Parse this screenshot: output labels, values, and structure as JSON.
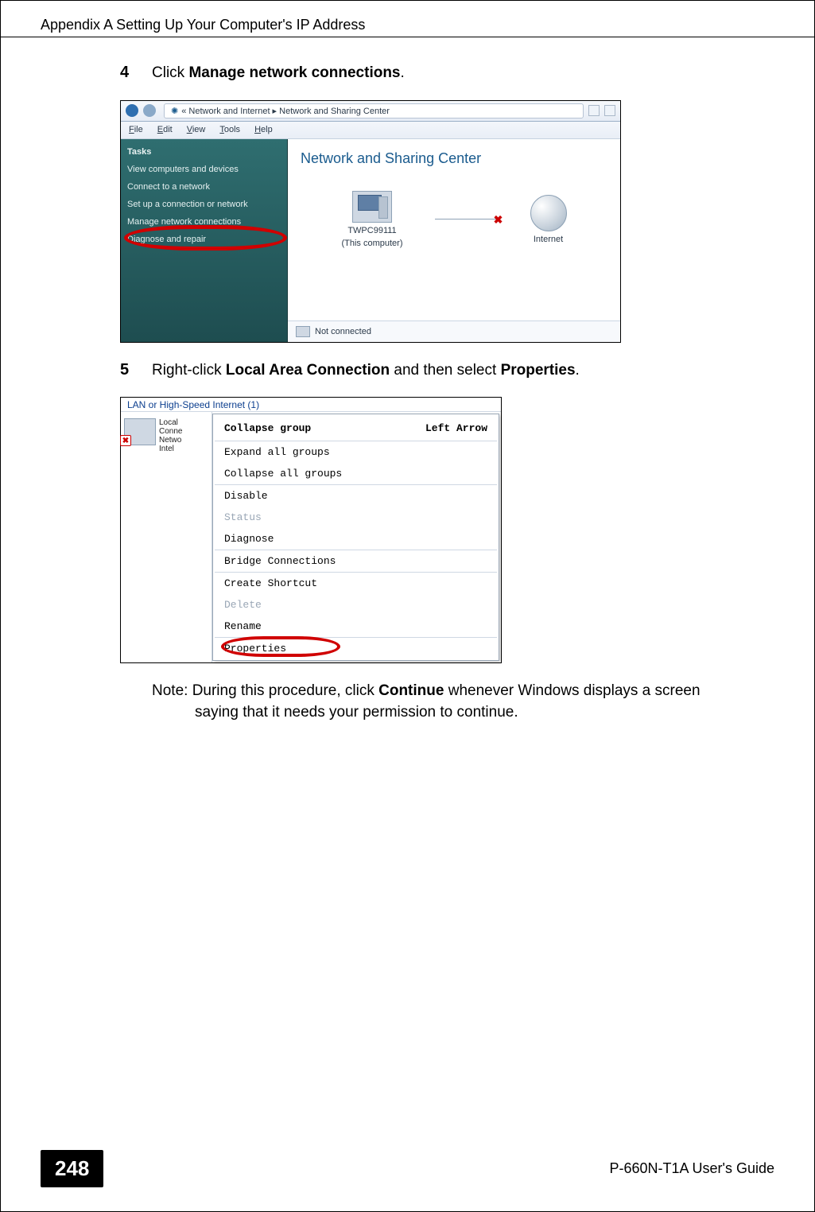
{
  "header": {
    "appendix_title": "Appendix A Setting Up Your Computer's IP Address"
  },
  "steps": {
    "s4": {
      "num": "4",
      "pre": "Click ",
      "bold": "Manage network connections",
      "post": "."
    },
    "s5": {
      "num": "5",
      "pre": "Right-click ",
      "bold1": "Local Area Connection",
      "mid": " and then select ",
      "bold2": "Properties",
      "post": "."
    }
  },
  "fig1": {
    "breadcrumb": "« Network and Internet  ▸  Network and Sharing Center",
    "menu": {
      "file": "File",
      "edit": "Edit",
      "view": "View",
      "tools": "Tools",
      "help": "Help"
    },
    "side": {
      "title": "Tasks",
      "items": [
        "View computers and devices",
        "Connect to a network",
        "Set up a connection or network",
        "Manage network connections",
        "Diagnose and repair"
      ]
    },
    "main_title": "Network and Sharing Center",
    "computer_name": "TWPC99111",
    "computer_sub": "(This computer)",
    "internet": "Internet",
    "status": "Not connected"
  },
  "fig2": {
    "group_label": "LAN or High-Speed Internet (1)",
    "conn": {
      "l1": "Local",
      "l2": "Conne",
      "l3": "Netwo",
      "l4": "Intel"
    },
    "menu": {
      "collapse_group": "Collapse group",
      "left_arrow": "Left Arrow",
      "expand_all": "Expand all groups",
      "collapse_all": "Collapse all groups",
      "disable": "Disable",
      "status": "Status",
      "diagnose": "Diagnose",
      "bridge": "Bridge Connections",
      "shortcut": "Create Shortcut",
      "delete": "Delete",
      "rename": "Rename",
      "properties": "Properties"
    }
  },
  "note": {
    "line1_pre": "Note: During this procedure, click ",
    "line1_bold": "Continue",
    "line1_post": " whenever Windows displays a screen",
    "line2": "saying that it needs your permission to continue."
  },
  "footer": {
    "page": "248",
    "guide": "P-660N-T1A User's Guide"
  }
}
